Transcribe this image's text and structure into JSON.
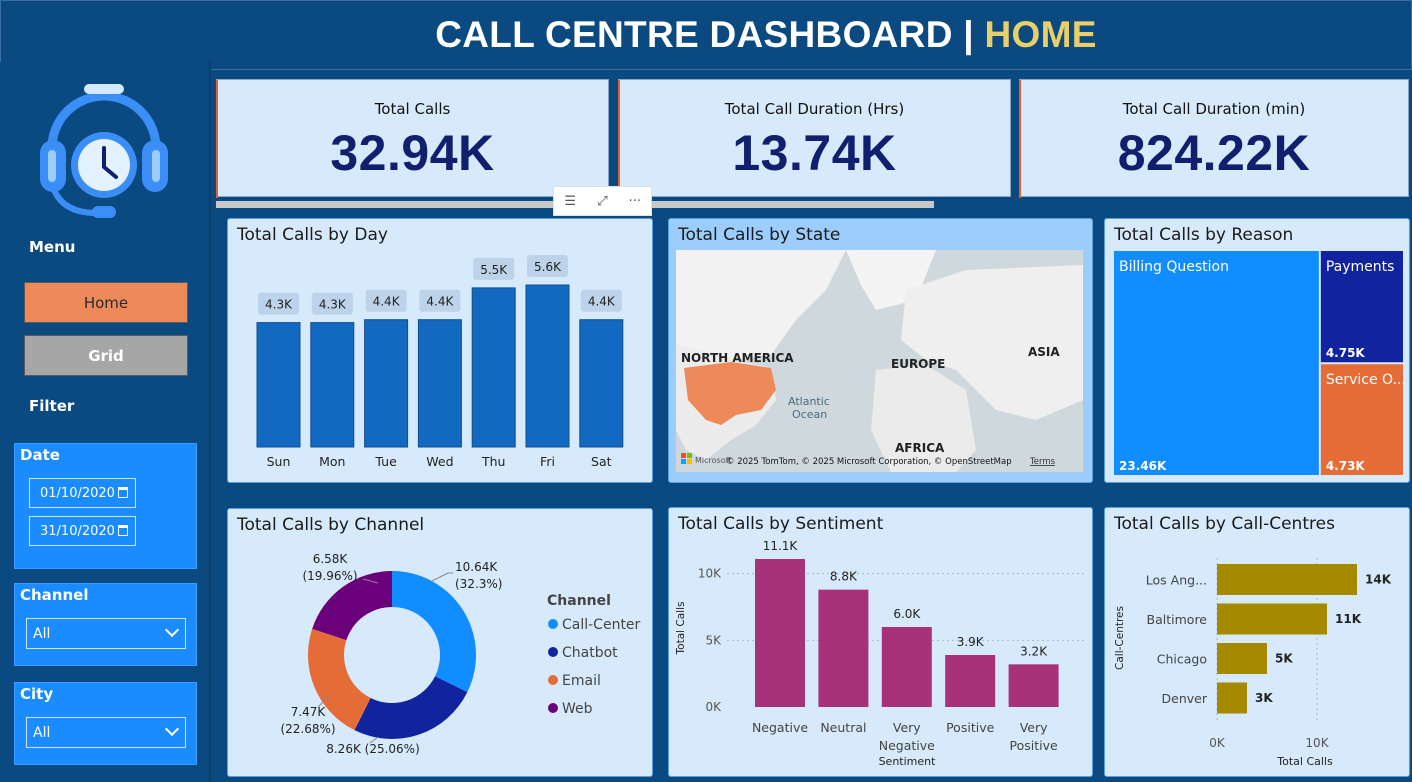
{
  "header": {
    "title_main": "CALL CENTRE DASHBOARD | ",
    "title_highlight": "HOME"
  },
  "sidebar": {
    "menu_title": "Menu",
    "buttons": {
      "home": "Home",
      "grid": "Grid"
    },
    "filter_title": "Filter",
    "date": {
      "label": "Date",
      "start": "01/10/2020",
      "end": "31/10/2020"
    },
    "channel": {
      "label": "Channel",
      "value": "All"
    },
    "city": {
      "label": "City",
      "value": "All"
    }
  },
  "kpis": [
    {
      "label": "Total Calls",
      "value": "32.94K"
    },
    {
      "label": "Total Call Duration (Hrs)",
      "value": "13.74K"
    },
    {
      "label": "Total Call Duration (min)",
      "value": "824.22K"
    }
  ],
  "colors": {
    "accent_orange": "#ee8a5a",
    "bar_blue": "#1368c0",
    "sentiment": "#a7327a",
    "callcentre": "#a58a00",
    "navy": "#11206e"
  },
  "map": {
    "title": "Total Calls by State",
    "labels": {
      "na": "NORTH AMERICA",
      "eu": "EUROPE",
      "asia": "ASIA",
      "africa": "AFRICA",
      "ocean1": "Atlantic",
      "ocean2": "Ocean"
    },
    "attribution": "© 2025 TomTom, © 2025 Microsoft Corporation, © OpenStreetMap",
    "terms": "Terms",
    "ms_logo": "Microsoft"
  },
  "chart_data": [
    {
      "type": "bar",
      "title": "Total Calls by Day",
      "categories": [
        "Sun",
        "Mon",
        "Tue",
        "Wed",
        "Thu",
        "Fri",
        "Sat"
      ],
      "values": [
        4300,
        4300,
        4400,
        4400,
        5500,
        5600,
        4400
      ],
      "labels": [
        "4.3K",
        "4.3K",
        "4.4K",
        "4.4K",
        "5.5K",
        "5.6K",
        "4.4K"
      ],
      "ylim": [
        0,
        5600
      ]
    },
    {
      "type": "treemap",
      "title": "Total Calls by Reason",
      "categories": [
        "Billing Question",
        "Payments",
        "Service O..."
      ],
      "values": [
        23460,
        4750,
        4730
      ],
      "labels": [
        "23.46K",
        "4.75K",
        "4.73K"
      ],
      "colors": [
        "#118dff",
        "#12239e",
        "#e66c37"
      ]
    },
    {
      "type": "pie",
      "title": "Total Calls by Channel",
      "legend_title": "Channel",
      "categories": [
        "Call-Center",
        "Chatbot",
        "Email",
        "Web"
      ],
      "values": [
        10640,
        8260,
        7470,
        6580
      ],
      "labels": [
        "10.64K",
        "8.26K (25.06%)",
        "7.47K",
        "6.58K"
      ],
      "pct_labels": [
        "(32.3%)",
        "",
        "(22.68%)",
        "(19.96%)"
      ],
      "colors": [
        "#118dff",
        "#12239e",
        "#e66c37",
        "#6b007b"
      ]
    },
    {
      "type": "bar",
      "title": "Total Calls by Sentiment",
      "categories": [
        "Negative",
        "Neutral",
        "Very Negative",
        "Positive",
        "Very Positive"
      ],
      "values": [
        11100,
        8800,
        6000,
        3900,
        3200
      ],
      "labels": [
        "11.1K",
        "8.8K",
        "6.0K",
        "3.9K",
        "3.2K"
      ],
      "xlabel": "Sentiment",
      "ylabel": "Total Calls",
      "yticks": [
        "0K",
        "5K",
        "10K"
      ],
      "ylim": [
        0,
        12000
      ]
    },
    {
      "type": "bar",
      "orientation": "horizontal",
      "title": "Total Calls by Call-Centres",
      "categories": [
        "Los Ang...",
        "Baltimore",
        "Chicago",
        "Denver"
      ],
      "values": [
        14000,
        11000,
        5000,
        3000
      ],
      "labels": [
        "14K",
        "11K",
        "5K",
        "3K"
      ],
      "xlabel": "Total Calls",
      "ylabel": "Call-Centres",
      "xticks": [
        "0K",
        "10K"
      ],
      "xlim": [
        0,
        15000
      ]
    }
  ]
}
